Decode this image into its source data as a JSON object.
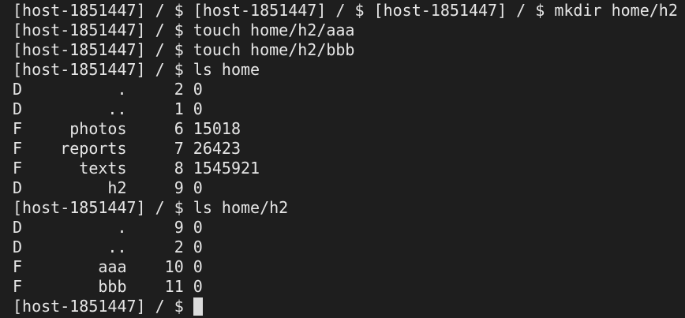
{
  "terminal": {
    "lines": [
      "[host-1851447] / $ [host-1851447] / $ [host-1851447] / $ mkdir home/h2",
      "[host-1851447] / $ touch home/h2/aaa",
      "[host-1851447] / $ touch home/h2/bbb",
      "[host-1851447] / $ ls home",
      "D          .     2 0",
      "D         ..     1 0",
      "F     photos     6 15018",
      "F    reports     7 26423",
      "F      texts     8 1545921",
      "D         h2     9 0",
      "[host-1851447] / $ ls home/h2",
      "D          .     9 0",
      "D         ..     2 0",
      "F        aaa    10 0",
      "F        bbb    11 0"
    ],
    "prompt": "[host-1851447] / $ ",
    "current_input": ""
  }
}
